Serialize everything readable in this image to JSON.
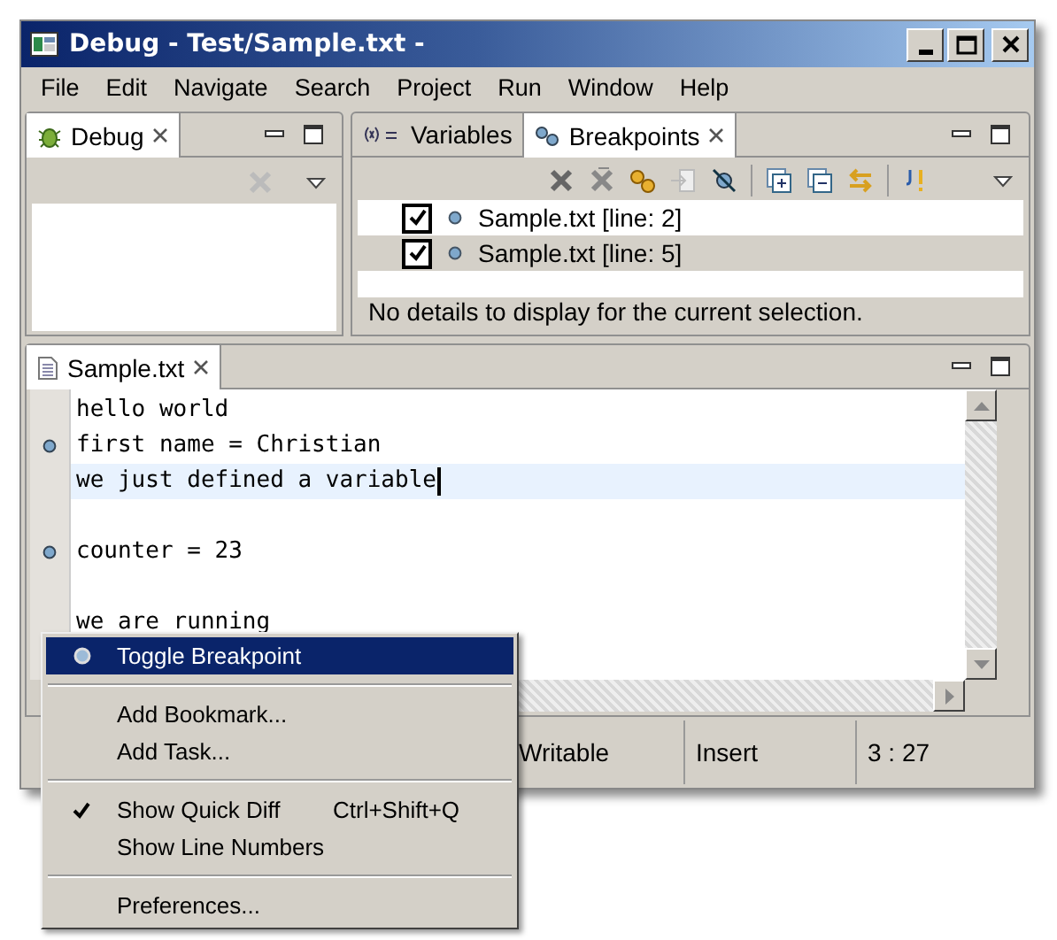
{
  "window": {
    "title": "Debug - Test/Sample.txt -"
  },
  "menu_bar": [
    "File",
    "Edit",
    "Navigate",
    "Search",
    "Project",
    "Run",
    "Window",
    "Help"
  ],
  "debug_view": {
    "tab": "Debug"
  },
  "breakpoints_view": {
    "tabs": [
      {
        "label": "Variables",
        "selected": false
      },
      {
        "label": "Breakpoints",
        "selected": true
      }
    ],
    "breakpoints": [
      {
        "label": "Sample.txt [line: 2]",
        "checked": true,
        "selected": false
      },
      {
        "label": "Sample.txt [line: 5]",
        "checked": true,
        "selected": true
      }
    ],
    "details": "No details to display for the current selection."
  },
  "editor": {
    "tab": "Sample.txt",
    "lines": [
      {
        "text": "hello world",
        "breakpoint": false,
        "current": false
      },
      {
        "text": "first name = Christian",
        "breakpoint": true,
        "current": false
      },
      {
        "text": "we just defined a variable",
        "breakpoint": false,
        "current": true
      },
      {
        "breakpoint": false,
        "current": false
      },
      {
        "text": "counter = 23",
        "breakpoint": true,
        "current": false
      },
      {
        "breakpoint": false,
        "current": false
      },
      {
        "text": "we are running",
        "breakpoint": false,
        "current": false
      }
    ]
  },
  "status_bar": [
    "Writable",
    "Insert",
    "3 : 27"
  ],
  "context_menu": [
    {
      "kind": "breakpoint-action",
      "label": "Toggle Breakpoint",
      "selected": true,
      "checked": false
    },
    {
      "kind": "separator"
    },
    {
      "kind": "action",
      "label": "Add Bookmark...",
      "selected": false,
      "checked": false
    },
    {
      "kind": "action",
      "label": "Add Task...",
      "selected": false,
      "checked": false
    },
    {
      "kind": "separator"
    },
    {
      "kind": "action",
      "label": "Show Quick Diff",
      "shortcut": "Ctrl+Shift+Q",
      "selected": false,
      "checked": true
    },
    {
      "kind": "action",
      "label": "Show Line Numbers",
      "selected": false,
      "checked": false
    },
    {
      "kind": "separator"
    },
    {
      "kind": "action",
      "label": "Preferences...",
      "selected": false,
      "checked": false
    }
  ]
}
